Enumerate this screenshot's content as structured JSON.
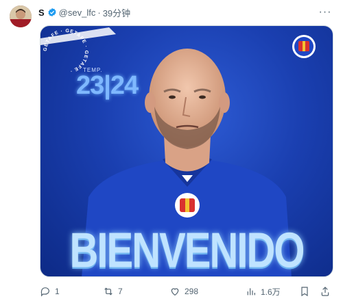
{
  "tweet": {
    "display_name": "S",
    "handle": "@sev_lfc",
    "separator": "·",
    "time": "39分钟",
    "more_label": "···"
  },
  "image": {
    "season_label": "TEMP.",
    "season_number": "23|24",
    "club_ring_text": "GETAFE · GETAFE · GETAFE ·",
    "headline": "BIENVENIDO",
    "colors": {
      "bg": "#1a3fb0",
      "glow": "#7fb8ff"
    }
  },
  "actions": {
    "reply_count": "1",
    "retweet_count": "7",
    "like_count": "298",
    "view_count": "1.6万"
  },
  "colors": {
    "verified": "#1d9bf0",
    "muted": "#536471"
  }
}
